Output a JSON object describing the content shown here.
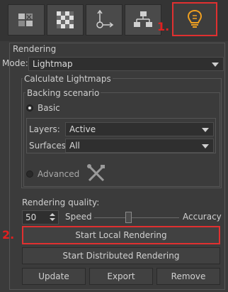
{
  "toolbar": {
    "tabs": [
      {
        "icon": "puzzle-icon",
        "active": false
      },
      {
        "icon": "checkerboard-icon",
        "active": false
      },
      {
        "icon": "path-flow-icon",
        "active": false
      },
      {
        "icon": "hierarchy-icon",
        "active": false
      },
      {
        "icon": "lightbulb-icon",
        "active": true
      }
    ],
    "step1_label": "1."
  },
  "rendering": {
    "group_label": "Rendering",
    "mode_label": "Mode:",
    "mode_value": "Lightmap"
  },
  "calculate": {
    "group_label": "Calculate Lightmaps",
    "backing_label": "Backing scenario",
    "basic_label": "Basic",
    "layers_label": "Layers:",
    "layers_value": "Active",
    "surfaces_label": "Surfaces:",
    "surfaces_value": "All",
    "advanced_label": "Advanced",
    "quality_label": "Rendering quality:",
    "quality_value": "50",
    "speed_label": "Speed",
    "accuracy_label": "Accuracy",
    "quality_slider_fraction": 0.4
  },
  "actions": {
    "step2_label": "2.",
    "start_local": "Start Local Rendering",
    "start_distributed": "Start Distributed Rendering",
    "update": "Update",
    "export": "Export",
    "remove": "Remove"
  },
  "colors": {
    "panel_bg": "#3b3b3b",
    "highlight": "#e03030",
    "bulb": "#f0a020"
  }
}
